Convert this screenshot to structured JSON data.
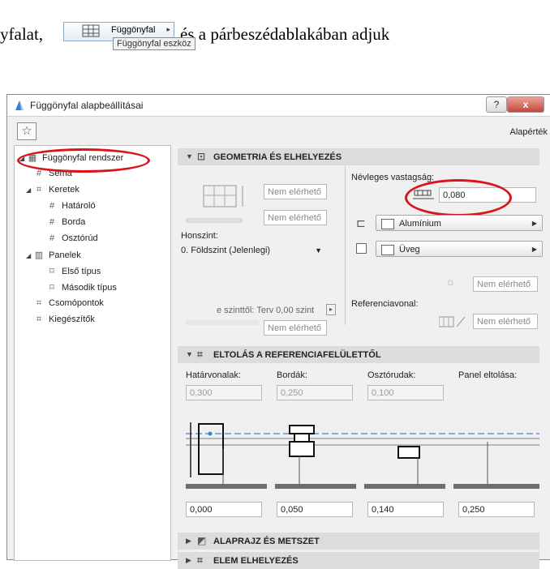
{
  "doc": {
    "text_before": "yfalat,",
    "text_after": "és a párbeszédablakában adjuk",
    "toolbar_button_label": "Függönyfal",
    "tooltip": "Függönyfal eszköz"
  },
  "dialog": {
    "title": "Függönyfal alapbeállításai",
    "help_label": "?",
    "close_label": "x",
    "default_label": "Alapérték"
  },
  "tree": [
    {
      "label": "Függönyfal rendszer",
      "icon": "curtain-wall-icon"
    },
    {
      "label": "Séma",
      "icon": "scheme-icon"
    },
    {
      "label": "Keretek",
      "icon": "frames-icon"
    },
    {
      "label": "Határoló",
      "icon": "boundary-frame-icon"
    },
    {
      "label": "Borda",
      "icon": "mullion-icon"
    },
    {
      "label": "Osztórúd",
      "icon": "transom-icon"
    },
    {
      "label": "Panelek",
      "icon": "panels-icon"
    },
    {
      "label": "Első típus",
      "icon": "panel-type-icon"
    },
    {
      "label": "Második típus",
      "icon": "panel-type-icon"
    },
    {
      "label": "Csomópontok",
      "icon": "junctions-icon"
    },
    {
      "label": "Kiegészítők",
      "icon": "accessories-icon"
    }
  ],
  "geometry": {
    "header": "GEOMETRIA ÉS ELHELYEZÉS",
    "na1": "Nem elérhető",
    "na2": "Nem elérhető",
    "home_story_label": "Honszint:",
    "home_story_value": "0. Földszint (Jelenlegi)",
    "offset_label": "e szinttől: Terv 0,00 szint",
    "na3": "Nem elérhető",
    "nominal_thickness_label": "Névleges vastagság:",
    "nominal_thickness_value": "0,080",
    "frame_material": "Alumínium",
    "panel_material": "Üveg",
    "na4": "Nem elérhető",
    "reference_line_label": "Referenciavonal:",
    "na5": "Nem elérhető"
  },
  "offset_section": {
    "header": "ELTOLÁS A REFERENCIAFELÜLETTŐL",
    "col_labels": [
      "Határvonalak:",
      "Bordák:",
      "Osztórudak:",
      "Panel eltolása:"
    ],
    "top_values": [
      "0,300",
      "0,250",
      "0,100"
    ],
    "bottom_values": [
      "0,000",
      "0,050",
      "0,140",
      "0,250"
    ]
  },
  "collapsed_sections": [
    "ALAPRAJZ ÉS METSZET",
    "ELEM ELHELYEZÉS"
  ],
  "colors": {
    "highlight": "#d9151a",
    "header_bg": "#dcdcdc",
    "dialog_bg": "#f0f0f0"
  }
}
